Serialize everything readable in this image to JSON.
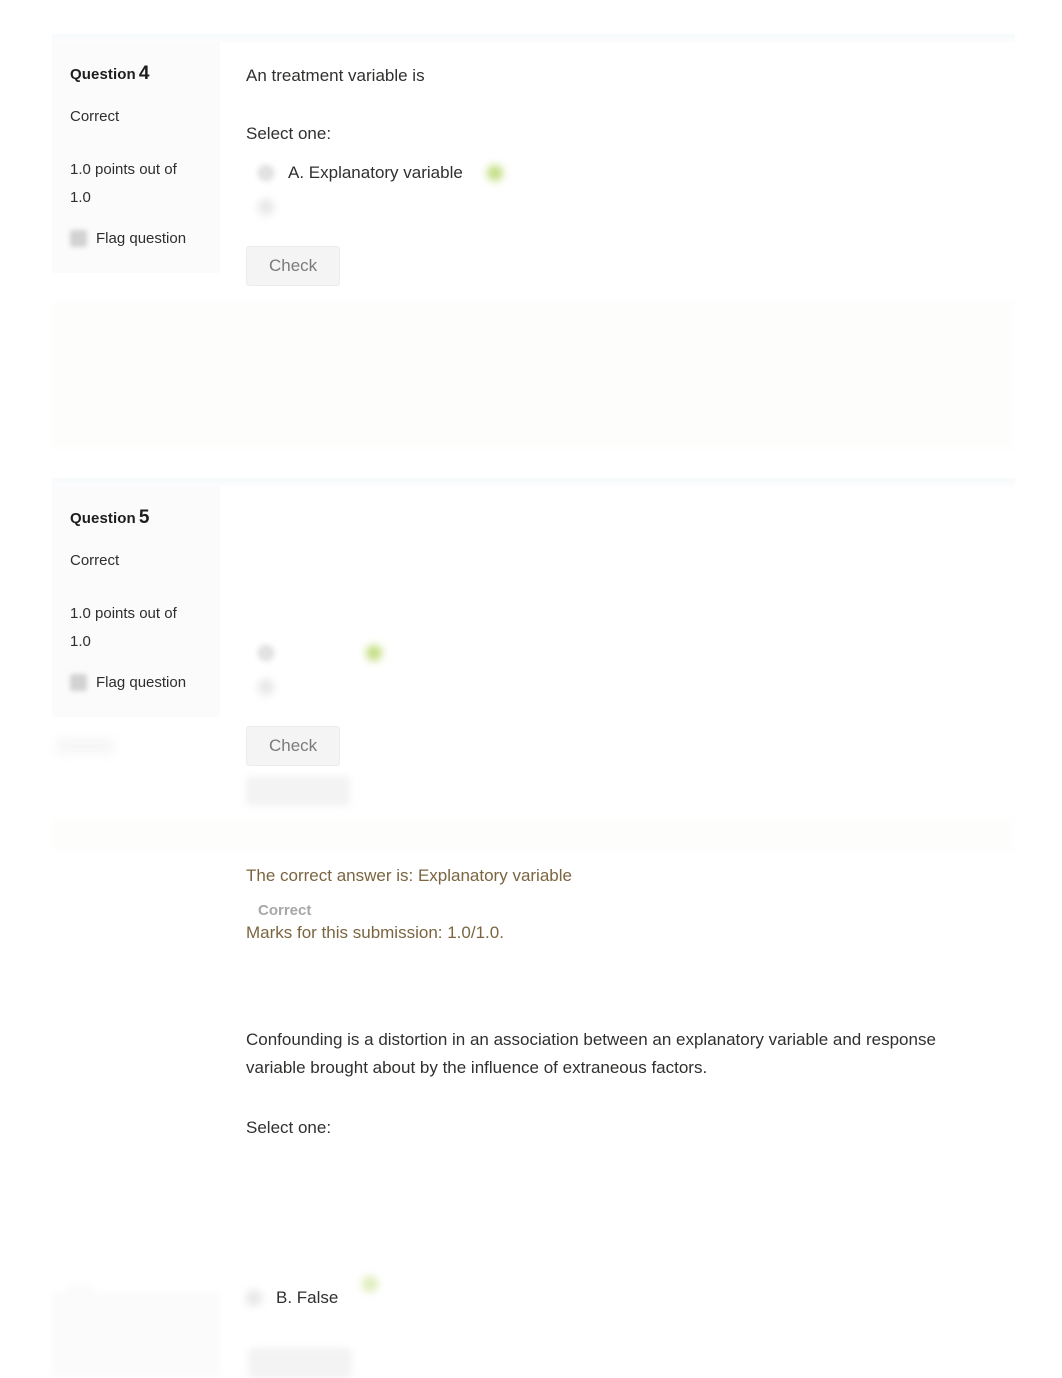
{
  "page": {
    "background_color": "#ffffff",
    "feedback_text_color": "#7a6540",
    "correct_tick_color": "#b9d56a"
  },
  "questions": [
    {
      "number_label": "Question",
      "number": "4",
      "state": "Correct",
      "grade": "1.0 points out of 1.0",
      "flag_label": "Flag question",
      "flag_icon": "flag-icon",
      "stem": "An treatment variable is",
      "select_prompt": "Select one:",
      "options": [
        {
          "key": "A",
          "label": "A. Explanatory variable",
          "selected": true,
          "marked_correct": true
        },
        {
          "key": "B",
          "label": "",
          "selected": false,
          "marked_correct": false
        }
      ],
      "check_button": "Check"
    },
    {
      "number_label": "Question",
      "number": "5",
      "state": "Correct",
      "grade": "1.0 points out of 1.0",
      "flag_label": "Flag question",
      "flag_icon": "flag-icon",
      "stem": "",
      "select_prompt": "",
      "options": [
        {
          "key": "A",
          "label": "",
          "selected": true,
          "marked_correct": true
        },
        {
          "key": "B",
          "label": "",
          "selected": false,
          "marked_correct": false
        }
      ],
      "check_button": "Check"
    }
  ],
  "feedback": {
    "correct_answer_line": "The correct answer is: Explanatory variable",
    "state_label": "Correct",
    "marks_line": "Marks for this submission: 1.0/1.0."
  },
  "prose": {
    "paragraph": "Confounding is a distortion in an association between an explanatory variable and response variable brought about by the influence of extraneous factors.",
    "select_prompt": "Select one:"
  },
  "next_question": {
    "option_b_label": "B. False"
  }
}
